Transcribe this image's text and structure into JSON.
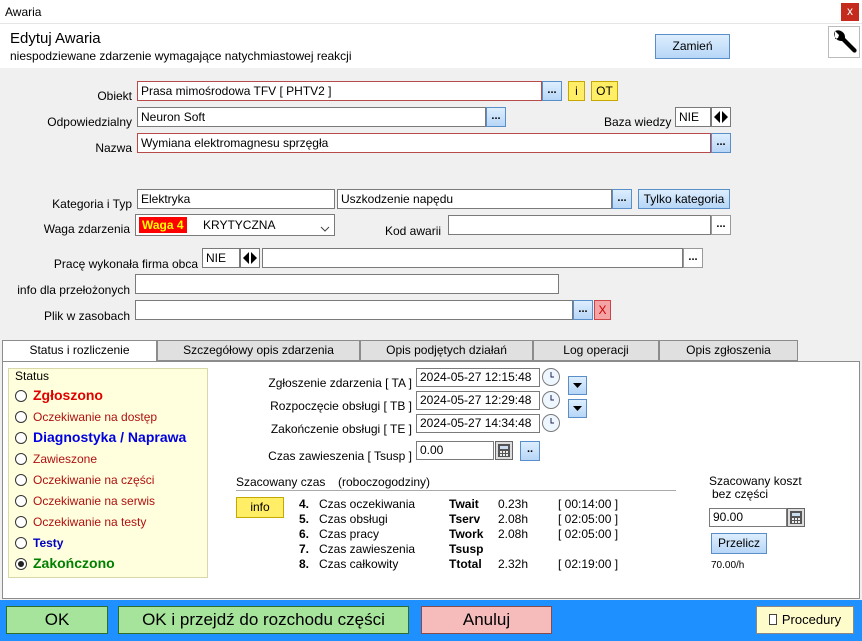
{
  "window": {
    "title": "Awaria",
    "close": "x"
  },
  "header": {
    "title": "Edytuj Awaria",
    "subtitle": "niespodziewane zdarzenie wymagające natychmiastowej reakcji",
    "change_btn": "Zamień"
  },
  "form": {
    "obiekt_label": "Obiekt",
    "obiekt_value": "Prasa mimośrodowa TFV [ PHTV2 ]",
    "info_btn": "i",
    "ot_btn": "OT",
    "odp_label": "Odpowiedzialny",
    "odp_value": "Neuron Soft",
    "baza_label": "Baza wiedzy",
    "baza_value": "NIE",
    "nazwa_label": "Nazwa",
    "nazwa_value": "Wymiana elektromagnesu sprzęgła",
    "kat_label": "Kategoria i Typ",
    "kat_value": "Elektryka",
    "typ_value": "Uszkodzenie napędu",
    "tylko_btn": "Tylko kategoria",
    "waga_label": "Waga zdarzenia",
    "waga_badge": "Waga 4",
    "waga_value": "KRYTYCZNA",
    "kod_label": "Kod awarii",
    "kod_value": "",
    "firma_label": "Pracę wykonała firma obca",
    "firma_value": "NIE",
    "firma_text": "",
    "info_label": "info dla przełożonych",
    "info_value": "",
    "plik_label": "Plik w zasobach",
    "plik_value": "",
    "plik_clear": "X",
    "dots": "..."
  },
  "tabs": [
    "Status i rozliczenie",
    "Szczegółowy opis zdarzenia",
    "Opis podjętych działań",
    "Log operacji",
    "Opis zgłoszenia"
  ],
  "status": {
    "title": "Status",
    "items": [
      {
        "label": "Zgłoszono",
        "color": "#e00000",
        "bold": true,
        "size": 14
      },
      {
        "label": "Oczekiwanie na dostęp",
        "color": "#b01010",
        "bold": false,
        "size": 12
      },
      {
        "label": "Diagnostyka / Naprawa",
        "color": "#0000e0",
        "bold": true,
        "size": 14
      },
      {
        "label": "Zawieszone",
        "color": "#b01010",
        "bold": false,
        "size": 12
      },
      {
        "label": "Oczekiwanie na części",
        "color": "#b01010",
        "bold": false,
        "size": 12
      },
      {
        "label": "Oczekiwanie na serwis",
        "color": "#b01010",
        "bold": false,
        "size": 12
      },
      {
        "label": "Oczekiwanie na testy",
        "color": "#b01010",
        "bold": false,
        "size": 12
      },
      {
        "label": "Testy",
        "color": "#0000c0",
        "bold": true,
        "size": 12
      },
      {
        "label": "Zakończono",
        "color": "#008000",
        "bold": true,
        "size": 14
      }
    ],
    "selected": 8
  },
  "times": {
    "ta_label": "Zgłoszenie zdarzenia [ TA ]",
    "ta_value": "2024-05-27 12:15:48",
    "tb_label": "Rozpoczęcie obsługi [ TB ]",
    "tb_value": "2024-05-27 12:29:48",
    "te_label": "Zakończenie obsługi [ TE ]",
    "te_value": "2024-05-27 14:34:48",
    "tsusp_label": "Czas zawieszenia [ Tsusp ]",
    "tsusp_value": "0.00",
    "tsusp_btn": ".."
  },
  "estimate": {
    "title": "Szacowany czas",
    "subtitle": "(roboczogodziny)",
    "info_btn": "info",
    "rows": [
      {
        "num": "4.",
        "name": "Czas oczekiwania",
        "code": "Twait",
        "val": "0.23h",
        "hm": "[ 00:14:00 ]"
      },
      {
        "num": "5.",
        "name": "Czas obsługi",
        "code": "Tserv",
        "val": "2.08h",
        "hm": "[ 02:05:00 ]"
      },
      {
        "num": "6.",
        "name": "Czas pracy",
        "code": "Twork",
        "val": "2.08h",
        "hm": "[ 02:05:00 ]"
      },
      {
        "num": "7.",
        "name": "Czas zawieszenia",
        "code": "Tsusp",
        "val": "",
        "hm": ""
      },
      {
        "num": "8.",
        "name": "Czas całkowity",
        "code": "Ttotal",
        "val": "2.32h",
        "hm": "[ 02:19:00 ]"
      }
    ]
  },
  "cost": {
    "title1": "Szacowany koszt",
    "title2": "bez części",
    "value": "90.00",
    "recalc_btn": "Przelicz",
    "rate": "70.00/h"
  },
  "footer": {
    "ok": "OK",
    "ok_parts": "OK i przejdź do rozchodu części",
    "cancel": "Anuluj",
    "procedures": "Procedury"
  }
}
